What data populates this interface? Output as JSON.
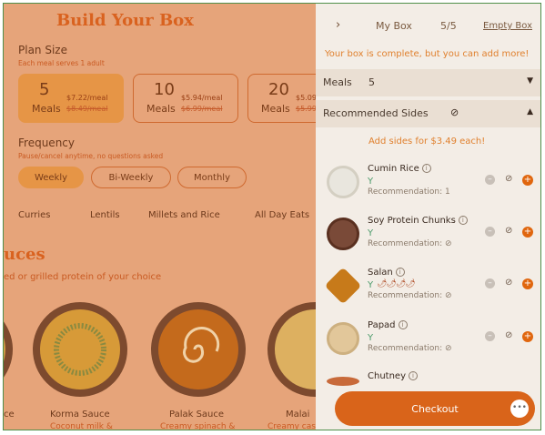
{
  "left": {
    "title": "Build Your Box",
    "plan_label": "Plan Size",
    "plan_sub": "Each meal serves 1 adult",
    "plans": [
      {
        "num": "5",
        "meals": "Meals",
        "price": "$7.22/meal",
        "old": "$8.49/meal"
      },
      {
        "num": "10",
        "meals": "Meals",
        "price": "$5.94/meal",
        "old": "$6.99/meal"
      },
      {
        "num": "20",
        "meals": "Meals",
        "price": "$5.09",
        "old": "$5.99"
      }
    ],
    "freq_label": "Frequency",
    "freq_sub": "Pause/cancel anytime, no questions asked",
    "freqs": [
      "Weekly",
      "Bi-Weekly",
      "Monthly"
    ],
    "categories": [
      "Curries",
      "Lentils",
      "Millets and Rice",
      "All Day Eats"
    ],
    "sauces_title": "uces",
    "sauces_sub": "ed or grilled protein of your choice",
    "sauces": [
      {
        "name": "Korma Sauce",
        "desc": "Coconut milk &"
      },
      {
        "name": "Palak Sauce",
        "desc": "Creamy spinach &"
      },
      {
        "name": "Malai",
        "desc": "Creamy cas"
      }
    ],
    "sauce_cut": "ce"
  },
  "panel": {
    "chevron": "›",
    "title": "My Box",
    "count": "5/5",
    "empty": "Empty Box",
    "complete": "Your box is complete, but you can add more!",
    "meals_label": "Meals",
    "meals_value": "5",
    "sides_label": "Recommended Sides",
    "sides_icon": "⊘",
    "add_sides": "Add sides for $3.49 each!",
    "items": [
      {
        "name": "Cumin Rice",
        "reco": "Recommendation: 1",
        "spice": ""
      },
      {
        "name": "Soy Protein Chunks",
        "reco": "Recommendation: ⊘",
        "spice": ""
      },
      {
        "name": "Salan",
        "reco": "Recommendation: ⊘",
        "spice": "🌶🌶🌶🌶"
      },
      {
        "name": "Papad",
        "reco": "Recommendation: ⊘",
        "spice": ""
      },
      {
        "name": "Chutney",
        "reco": "",
        "spice": ""
      }
    ],
    "checkout": "Checkout",
    "chat": "•••"
  },
  "colors": {
    "accent": "#d9641a",
    "panel_bg": "#f3ede6",
    "overlay": "#e6a47a"
  },
  "icons": {
    "info": "i",
    "veg": "Y",
    "minus": "–",
    "plus": "+",
    "ban": "⊘",
    "caret_down": "▼",
    "caret_up": "▲"
  }
}
